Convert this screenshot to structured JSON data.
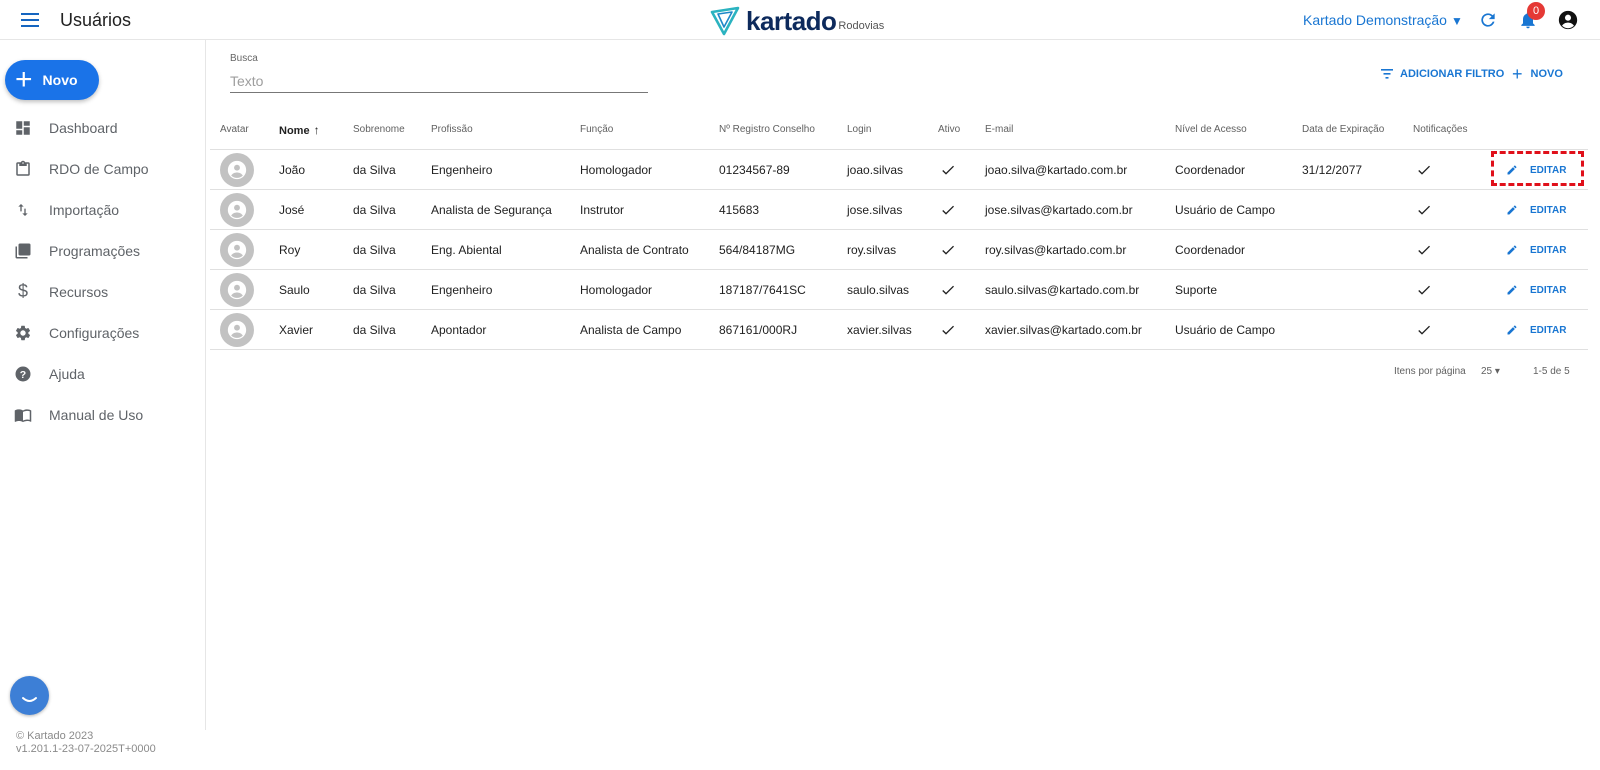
{
  "header": {
    "title": "Usuários",
    "logo_text": "kartado",
    "logo_sub": "Rodovias",
    "company": "Kartado Demonstração",
    "notification_count": "0",
    "colors": {
      "primary": "#1976d2",
      "badge": "#e53935",
      "logo": "#0d2a5c"
    }
  },
  "sidebar": {
    "new_button": "Novo",
    "items": [
      {
        "label": "Dashboard",
        "icon": "dashboard-icon"
      },
      {
        "label": "RDO de Campo",
        "icon": "clipboard-icon"
      },
      {
        "label": "Importação",
        "icon": "import-arrows-icon"
      },
      {
        "label": "Programações",
        "icon": "library-books-icon"
      },
      {
        "label": "Recursos",
        "icon": "dollar-icon"
      },
      {
        "label": "Configurações",
        "icon": "gear-icon"
      },
      {
        "label": "Ajuda",
        "icon": "help-circle-icon"
      },
      {
        "label": "Manual de Uso",
        "icon": "book-icon"
      }
    ],
    "footer_line1": "© Kartado 2023",
    "footer_line2": "v1.201.1-23-07-2025T+0000"
  },
  "search": {
    "label": "Busca",
    "placeholder": "Texto",
    "value": ""
  },
  "actions": {
    "add_filter": "ADICIONAR FILTRO",
    "new": "NOVO"
  },
  "table": {
    "columns": [
      "Avatar",
      "Nome",
      "Sobrenome",
      "Profissão",
      "Função",
      "Nº Registro Conselho",
      "Login",
      "Ativo",
      "E-mail",
      "Nível de Acesso",
      "Data de Expiração",
      "Notificações"
    ],
    "sorted_column": "Nome",
    "sort_direction": "ascending",
    "edit_label": "EDITAR",
    "rows": [
      {
        "nome": "João",
        "sobrenome": "da Silva",
        "profissao": "Engenheiro",
        "funcao": "Homologador",
        "registro": "01234567-89",
        "login": "joao.silvas",
        "ativo": true,
        "email": "joao.silva@kartado.com.br",
        "nivel": "Coordenador",
        "expiracao": "31/12/2077",
        "notificacoes": true
      },
      {
        "nome": "José",
        "sobrenome": "da Silva",
        "profissao": "Analista de Segurança",
        "funcao": "Instrutor",
        "registro": "415683",
        "login": "jose.silvas",
        "ativo": true,
        "email": "jose.silvas@kartado.com.br",
        "nivel": "Usuário de Campo",
        "expiracao": "",
        "notificacoes": true
      },
      {
        "nome": "Roy",
        "sobrenome": "da Silva",
        "profissao": "Eng. Abiental",
        "funcao": "Analista de Contrato",
        "registro": "564/84187MG",
        "login": "roy.silvas",
        "ativo": true,
        "email": "roy.silvas@kartado.com.br",
        "nivel": "Coordenador",
        "expiracao": "",
        "notificacoes": true
      },
      {
        "nome": "Saulo",
        "sobrenome": "da Silva",
        "profissao": "Engenheiro",
        "funcao": "Homologador",
        "registro": "187187/7641SC",
        "login": "saulo.silvas",
        "ativo": true,
        "email": "saulo.silvas@kartado.com.br",
        "nivel": "Suporte",
        "expiracao": "",
        "notificacoes": true
      },
      {
        "nome": "Xavier",
        "sobrenome": "da Silva",
        "profissao": "Apontador",
        "funcao": "Analista de Campo",
        "registro": "867161/000RJ",
        "login": "xavier.silvas",
        "ativo": true,
        "email": "xavier.silvas@kartado.com.br",
        "nivel": "Usuário de Campo",
        "expiracao": "",
        "notificacoes": true
      }
    ]
  },
  "pagination": {
    "label": "Itens por página",
    "per_page": "25",
    "range": "1-5 de 5"
  }
}
